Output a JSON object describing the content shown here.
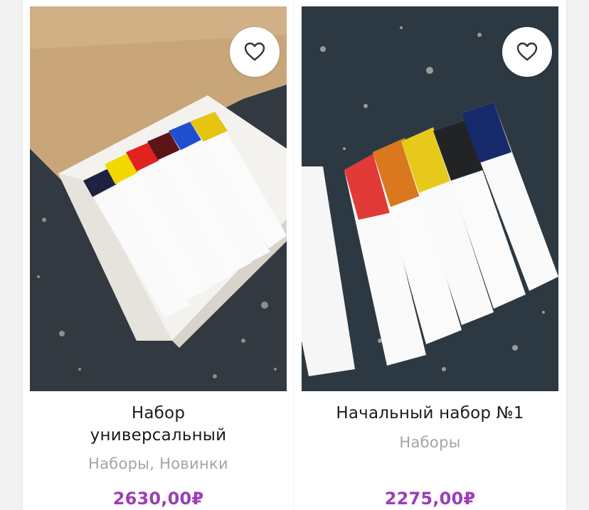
{
  "products": [
    {
      "title_line1": "Набор",
      "title_line2": "универсальный",
      "category_1": "Наборы",
      "category_sep": ", ",
      "category_2": "Новинки",
      "price": "2630,00₽",
      "favorite_icon": "heart-outline-icon"
    },
    {
      "title_line1": "Начальный набор №1",
      "category_1": "Наборы",
      "price": "2275,00₽",
      "favorite_icon": "heart-outline-icon"
    }
  ],
  "colors": {
    "price": "#9b3fb5",
    "category": "#a4a4a4",
    "title": "#1c1c1c",
    "card": "#ffffff",
    "page": "#f2f2f2"
  }
}
